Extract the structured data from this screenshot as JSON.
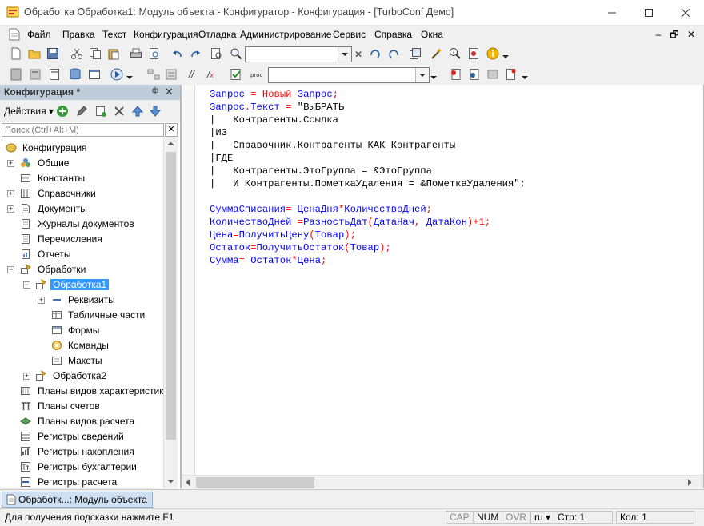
{
  "window": {
    "title": "Обработка Обработка1: Модуль объекта - Конфигуратор - Конфигурация - [TurboConf Демо]",
    "controls": [
      "—",
      "☐",
      "✕"
    ]
  },
  "menu": {
    "items": [
      "Файл",
      "Правка",
      "Текст",
      "Конфигурация",
      "Отладка",
      "Администрирование",
      "Сервис",
      "Справка",
      "Окна"
    ],
    "mdi_controls": [
      "‒",
      "🗗",
      "✕"
    ]
  },
  "left_panel": {
    "title": "Конфигурация *",
    "header_controls": [
      "ф",
      "✕"
    ],
    "actions_label": "Действия",
    "search_placeholder": "Поиск (Ctrl+Alt+M)",
    "search_clear": "✕",
    "tree": [
      {
        "label": "Конфигурация",
        "icon": "config-icon"
      },
      {
        "label": "Общие",
        "icon": "common-icon"
      },
      {
        "label": "Константы",
        "icon": "constants-icon"
      },
      {
        "label": "Справочники",
        "icon": "catalogs-icon"
      },
      {
        "label": "Документы",
        "icon": "documents-icon"
      },
      {
        "label": "Журналы документов",
        "icon": "journals-icon"
      },
      {
        "label": "Перечисления",
        "icon": "enums-icon"
      },
      {
        "label": "Отчеты",
        "icon": "reports-icon"
      },
      {
        "label": "Обработки",
        "icon": "dataprocessors-icon"
      },
      {
        "label": "Обработка1",
        "icon": "dataprocessor-icon"
      },
      {
        "label": "Реквизиты",
        "icon": "attributes-icon"
      },
      {
        "label": "Табличные части",
        "icon": "tabular-icon"
      },
      {
        "label": "Формы",
        "icon": "forms-icon"
      },
      {
        "label": "Команды",
        "icon": "commands-icon"
      },
      {
        "label": "Макеты",
        "icon": "templates-icon"
      },
      {
        "label": "Обработка2",
        "icon": "dataprocessor-icon"
      },
      {
        "label": "Планы видов характеристик",
        "icon": "chartofcharacteristics-icon"
      },
      {
        "label": "Планы счетов",
        "icon": "chartofaccounts-icon"
      },
      {
        "label": "Планы видов расчета",
        "icon": "chartofcalc-icon"
      },
      {
        "label": "Регистры сведений",
        "icon": "inforegisters-icon"
      },
      {
        "label": "Регистры накопления",
        "icon": "accumregisters-icon"
      },
      {
        "label": "Регистры бухгалтерии",
        "icon": "accountingregisters-icon"
      },
      {
        "label": "Регистры расчета",
        "icon": "calcregisters-icon"
      }
    ]
  },
  "editor": {
    "lines": [
      "Запрос = Новый Запрос;",
      "Запрос.Текст = \"ВЫБРАТЬ",
      "|   Контрагенты.Ссылка",
      "|ИЗ",
      "|   Справочник.Контрагенты КАК Контрагенты",
      "|ГДЕ",
      "|   Контрагенты.ЭтоГруппа = &ЭтоГруппа",
      "|   И Контрагенты.ПометкаУдаления = &ПометкаУдаления\";",
      "",
      "СуммаСписания= ЦенаДня*КоличествоДней;",
      "КоличествоДней =РазностьДат(ДатаНач, ДатаКон)+1;",
      "Цена=ПолучитьЦену(Товар);",
      "Остаток=ПолучитьОстаток(Товар);",
      "Сумма= Остаток*Цена;"
    ],
    "colors": {
      "keyword": "#ff0000",
      "identifier": "#0000ff",
      "string": "#000000"
    }
  },
  "tabs": {
    "active": "Обработк...: Модуль объекта"
  },
  "status": {
    "hint": "Для получения подсказки нажмите F1",
    "cap": "CAP",
    "num": "NUM",
    "ovr": "OVR",
    "lang": "ru",
    "row": "Стр: 1",
    "col": "Кол: 1"
  }
}
